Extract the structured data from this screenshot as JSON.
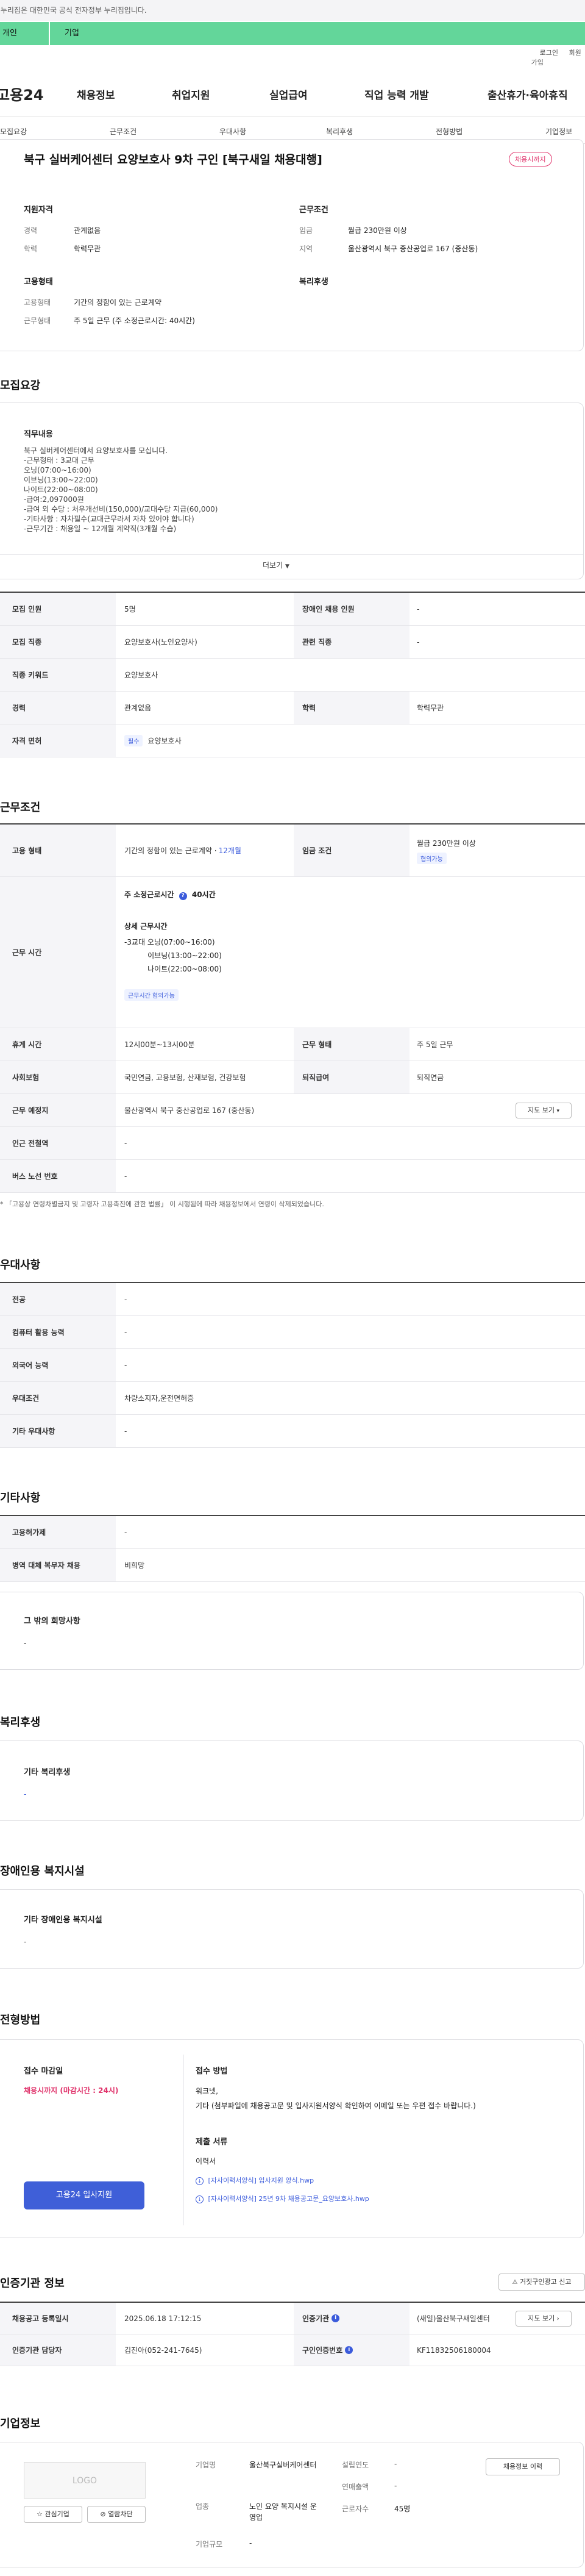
{
  "gov_notice": "이 누리집은 대한민국 공식 전자정부 누리집입니다.",
  "user_tabs": [
    "개인",
    "기업"
  ],
  "util_links": [
    "로그인",
    "회원가입"
  ],
  "site_logo": "고용24",
  "gnb": [
    "채용정보",
    "취업지원",
    "실업급여",
    "직업 능력 개발",
    "출산휴가·육아휴직"
  ],
  "sub_tabs": [
    "모집요강",
    "근무조건",
    "우대사항",
    "복리후생",
    "전형방법",
    "기업정보"
  ],
  "job": {
    "title": "북구 실버케어센터 요양보호사 9차 구인 [북구새일 채용대행]",
    "status_badge": "채용시까지",
    "qual_h": "지원자격",
    "qual": [
      {
        "k": "경력",
        "v": "관계없음"
      },
      {
        "k": "학력",
        "v": "학력무관"
      }
    ],
    "cond_h": "근무조건",
    "cond": [
      {
        "k": "임금",
        "v": "월급 230만원 이상"
      },
      {
        "k": "지역",
        "v": "울산광역시 북구 중산공업로 167 (중산동)"
      }
    ],
    "emp_h": "고용형태",
    "emp": [
      {
        "k": "고용형태",
        "v": "기간의 정함이 있는 근로계약"
      },
      {
        "k": "근무형태",
        "v": "주 5일 근무 (주 소정근로시간: 40시간)"
      }
    ],
    "welfare_h": "복리후생"
  },
  "recruit": {
    "section": "모집요강",
    "duty_h": "직무내용",
    "duty": "북구 실버케어센터에서 요양보호사를 모십니다.\n-근무형태 : 3교대 근무\n 오닝(07:00~16:00)\n 이브닝(13:00~22:00)\n 나이트(22:00~08:00)\n-급여:2,097000원\n-급여 외 수당 : 처우개선비(150,000)/교대수당 지급(60,000)\n-기타사항 : 자차필수(교대근무라서 자차 있어야 합니다)\n-근무기간 : 채용일 ~ 12개월 계약직(3개월 수습)",
    "more": "더보기",
    "rows": [
      {
        "k": "모집 인원",
        "v": "5명",
        "k2": "장애인 채용 인원",
        "v2": "-"
      },
      {
        "k": "모집 직종",
        "v": "요양보호사(노인요양사)",
        "k2": "관련 직종",
        "v2": "-"
      },
      {
        "k": "직종 키워드",
        "v": "요양보호사"
      },
      {
        "k": "경력",
        "v": "관계없음",
        "k2": "학력",
        "v2": "학력무관"
      },
      {
        "k": "자격 면허",
        "chip": "필수",
        "v": "요양보호사"
      }
    ]
  },
  "work": {
    "section": "근무조건",
    "emp_type_k": "고용 형태",
    "emp_type_v": "기간의 정함이 있는 근로계약 · ",
    "emp_type_months": "12개월",
    "wage_k": "임금 조건",
    "wage_v": "월급 230만원 이상",
    "wage_chip": "협의가능",
    "hours_k": "근무 시간",
    "hours_week": "주 소정근로시간",
    "hours_week_v": "40시간",
    "hours_detail_h": "상세 근무시간",
    "hours_detail": "-3교대 오닝(07:00~16:00)\n          이브닝(13:00~22:00)\n          나이트(22:00~08:00)",
    "hours_chip": "근무시간 협의가능",
    "rows": [
      {
        "k": "휴게 시간",
        "v": "12시00분~13시00분",
        "k2": "근무 형태",
        "v2": "주 5일 근무"
      },
      {
        "k": "사회보험",
        "v": "국민연금, 고용보험, 산재보험, 건강보험",
        "k2": "퇴직급여",
        "v2": "퇴직연금"
      },
      {
        "k": "근무 예정지",
        "v": "울산광역시 북구 중산공업로 167 (중산동)",
        "btn": "지도 보기"
      },
      {
        "k": "인근 전철역",
        "v": "-"
      },
      {
        "k": "버스 노선 번호",
        "v": "-"
      }
    ],
    "note": "* 「고용상 연령차별금지 및 고령자 고용촉진에 관한 법률」 이 시행됨에 따라 채용정보에서 연령이 삭제되었습니다."
  },
  "pref": {
    "section": "우대사항",
    "rows": [
      {
        "k": "전공",
        "v": "-"
      },
      {
        "k": "컴퓨터 활용 능력",
        "v": "-"
      },
      {
        "k": "외국어 능력",
        "v": "-"
      },
      {
        "k": "우대조건",
        "v": "차량소지자,운전면허증"
      },
      {
        "k": "기타 우대사항",
        "v": "-"
      }
    ]
  },
  "etc": {
    "section": "기타사항",
    "rows": [
      {
        "k": "고용허가제",
        "v": "-"
      },
      {
        "k": "병역 대체 복무자 채용",
        "v": "비희망"
      }
    ],
    "hope_h": "그 밖의 희망사항",
    "hope_v": "-"
  },
  "benefit": {
    "section": "복리후생",
    "h": "기타 복리후생",
    "v": "-"
  },
  "disability": {
    "section": "장애인용 복지시설",
    "h": "기타 장애인용 복지시설",
    "v": "-"
  },
  "process": {
    "section": "전형방법",
    "deadline_h": "접수 마감일",
    "deadline_v": "채용시까지 (마감시간 : 24시)",
    "method_h": "접수 방법",
    "method_v": "워크넷,\n기타 (첨부파일에 채용공고문 및 입사지원서양식 확인하여 이메일 또는 우편 접수 바랍니다.)",
    "docs_h": "제출 서류",
    "docs_v": "이력서",
    "files": [
      "[자사이력서양식] 입사지원 양식.hwp",
      "[자사이력서양식] 25년 9차 채용공고문_요양보호사.hwp"
    ],
    "apply_btn": "고용24 입사지원"
  },
  "agency": {
    "section": "인증기관 정보",
    "report_btn": "거짓구인광고 신고",
    "rows": [
      {
        "k": "채용공고 등록일시",
        "v": "2025.06.18 17:12:15",
        "k2": "인증기관",
        "v2": "(새일)울산북구새일센터",
        "btn": "지도 보기"
      },
      {
        "k": "인증기관 담당자",
        "v": "김진아(052-241-7645)",
        "k2": "구인인증번호",
        "v2": "KF11832506180004"
      }
    ]
  },
  "company": {
    "section": "기업정보",
    "logo": "LOGO",
    "fav_btn": "관심기업",
    "block_btn": "열람차단",
    "name_k": "기업명",
    "name_v": "울산북구실버케어센터",
    "industry_k": "업종",
    "industry_v": "노인 요양 복지시설 운영업",
    "scale_k": "기업규모",
    "scale_v": "-",
    "founded_k": "설립연도",
    "founded_v": "-",
    "sales_k": "연매출액",
    "sales_v": "-",
    "emp_k": "근로자수",
    "emp_v": "45명",
    "info_btn": "채용정보 이력"
  }
}
